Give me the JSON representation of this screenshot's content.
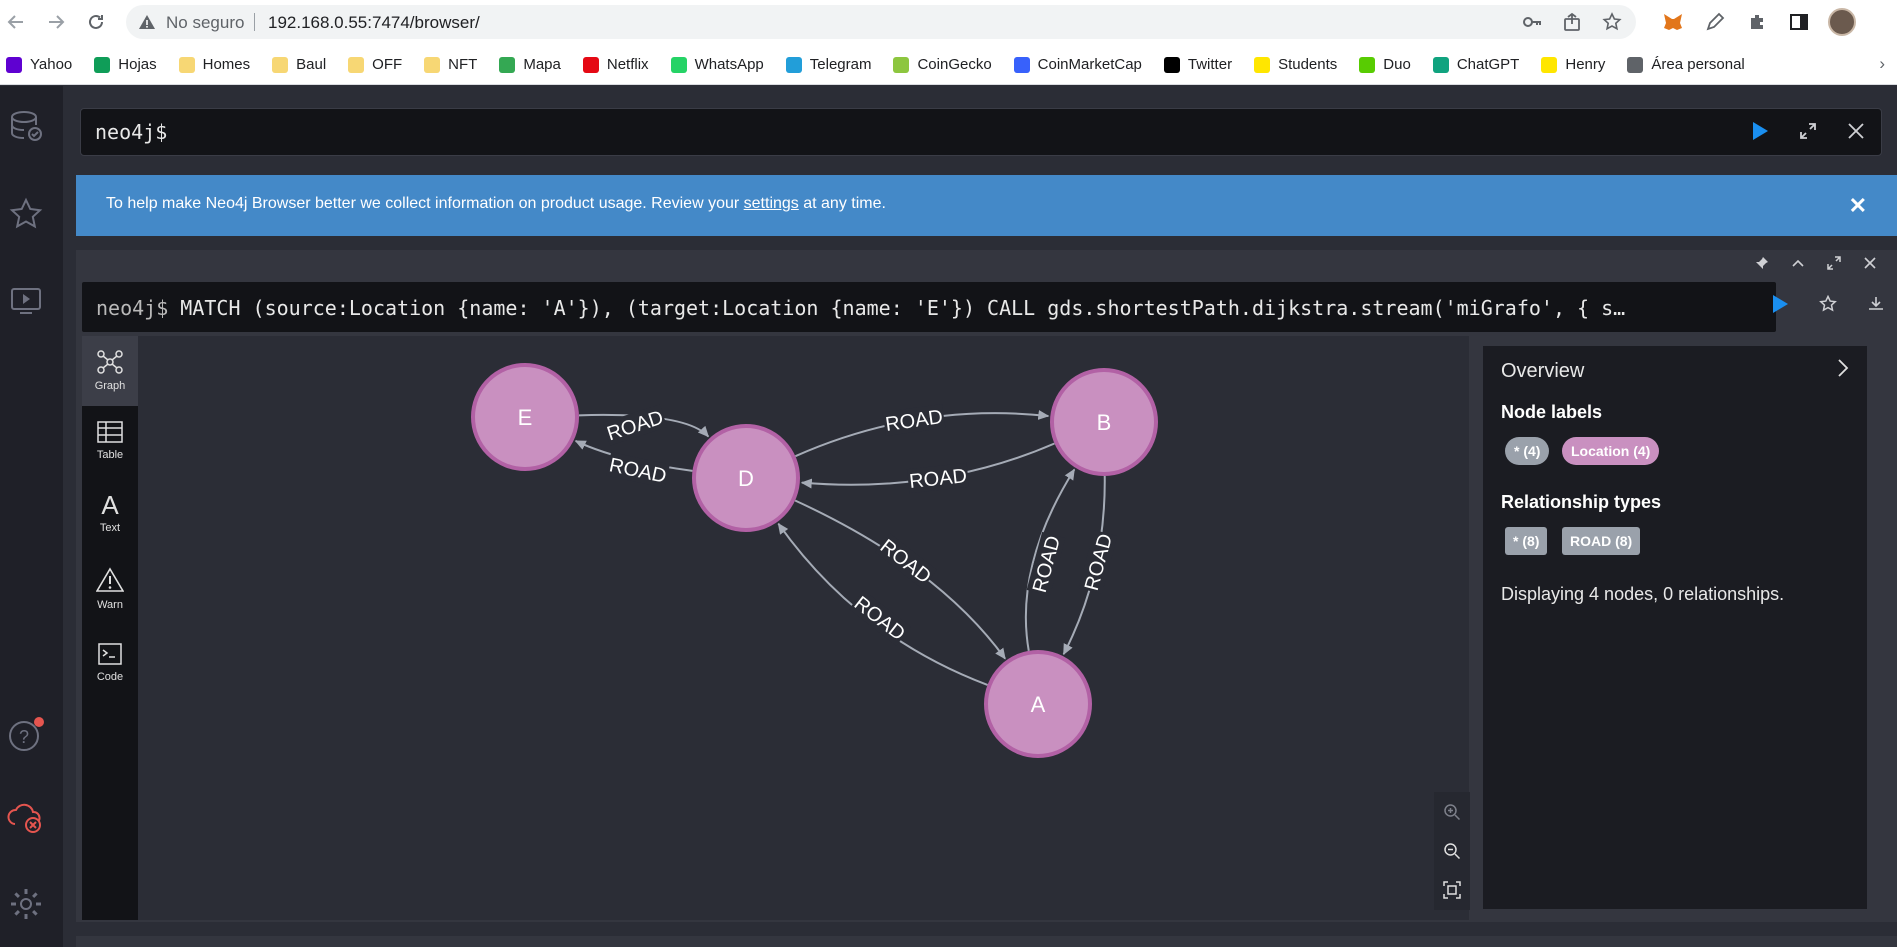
{
  "browser": {
    "security_label": "No seguro",
    "url": "192.168.0.55:7474/browser/"
  },
  "bookmarks": [
    {
      "label": "Yahoo",
      "color": "#5f01d1"
    },
    {
      "label": "Hojas",
      "color": "#0f9d58"
    },
    {
      "label": "Homes",
      "color": "#f7d774"
    },
    {
      "label": "Baul",
      "color": "#f7d774"
    },
    {
      "label": "OFF",
      "color": "#f7d774"
    },
    {
      "label": "NFT",
      "color": "#f7d774"
    },
    {
      "label": "Mapa",
      "color": "#34a853"
    },
    {
      "label": "Netflix",
      "color": "#e50914"
    },
    {
      "label": "WhatsApp",
      "color": "#25d366"
    },
    {
      "label": "Telegram",
      "color": "#229ed9"
    },
    {
      "label": "CoinGecko",
      "color": "#8dc63f"
    },
    {
      "label": "CoinMarketCap",
      "color": "#3861fb"
    },
    {
      "label": "Twitter",
      "color": "#000000"
    },
    {
      "label": "Students",
      "color": "#ffe600"
    },
    {
      "label": "Duo",
      "color": "#58cc02"
    },
    {
      "label": "ChatGPT",
      "color": "#10a37f"
    },
    {
      "label": "Henry",
      "color": "#ffe600"
    },
    {
      "label": "Área personal",
      "color": "#5f6368"
    }
  ],
  "editor": {
    "prompt": "neo4j$"
  },
  "banner": {
    "text_before": "To help make Neo4j Browser better we collect information on product usage. Review your ",
    "link": "settings",
    "text_after": " at any time.",
    "close": "✕"
  },
  "frame": {
    "prompt": "neo4j$",
    "query": "MATCH (source:Location {name: 'A'}), (target:Location {name: 'E'}) CALL gds.shortestPath.dijkstra.stream('miGrafo', { s…"
  },
  "view_tabs": [
    {
      "label": "Graph",
      "icon": "graph-icon",
      "active": true
    },
    {
      "label": "Table",
      "icon": "table-icon",
      "active": false
    },
    {
      "label": "Text",
      "icon": "text-icon",
      "active": false
    },
    {
      "label": "Warn",
      "icon": "warn-icon",
      "active": false
    },
    {
      "label": "Code",
      "icon": "code-icon",
      "active": false
    }
  ],
  "graph": {
    "node_color": "#c990c0",
    "node_border": "#b261a5",
    "nodes": [
      {
        "id": "E",
        "label": "E"
      },
      {
        "id": "D",
        "label": "D"
      },
      {
        "id": "B",
        "label": "B"
      },
      {
        "id": "A",
        "label": "A"
      }
    ],
    "relationships": [
      {
        "from": "E",
        "to": "D",
        "type": "ROAD"
      },
      {
        "from": "D",
        "to": "E",
        "type": "ROAD"
      },
      {
        "from": "D",
        "to": "B",
        "type": "ROAD"
      },
      {
        "from": "B",
        "to": "D",
        "type": "ROAD"
      },
      {
        "from": "D",
        "to": "A",
        "type": "ROAD"
      },
      {
        "from": "A",
        "to": "D",
        "type": "ROAD"
      },
      {
        "from": "A",
        "to": "B",
        "type": "ROAD"
      },
      {
        "from": "B",
        "to": "A",
        "type": "ROAD"
      }
    ]
  },
  "overview": {
    "title": "Overview",
    "node_labels_heading": "Node labels",
    "node_label_all": "* (4)",
    "node_label_location": "Location (4)",
    "rel_types_heading": "Relationship types",
    "rel_type_all": "* (8)",
    "rel_type_road": "ROAD (8)",
    "message": "Displaying 4 nodes, 0 relationships."
  }
}
